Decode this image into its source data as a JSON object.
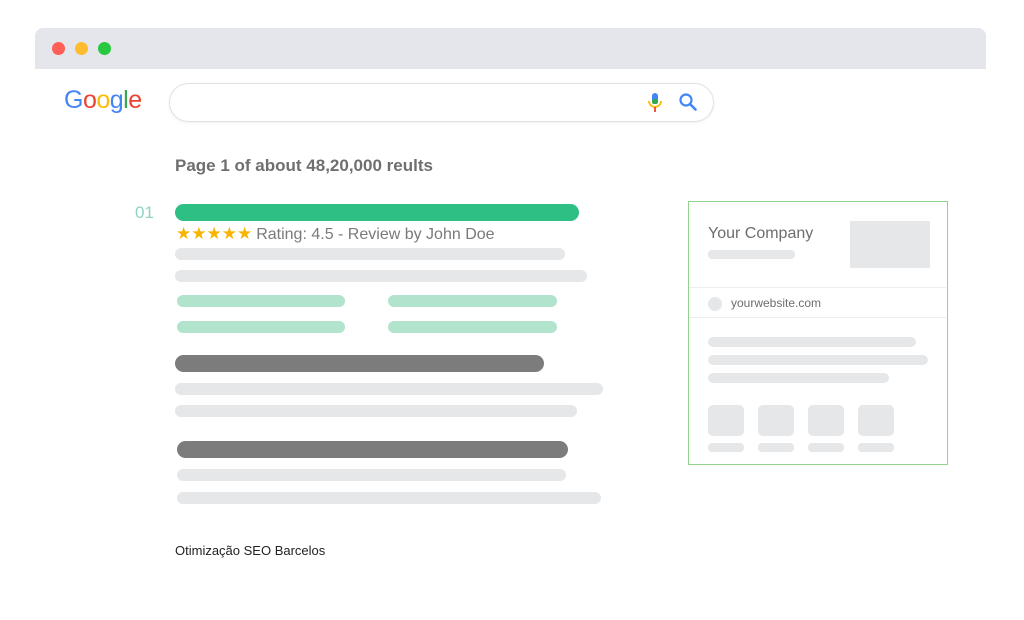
{
  "browser": {
    "window_controls": [
      "close",
      "minimize",
      "maximize"
    ],
    "colors": {
      "close": "#fe5f57",
      "minimize": "#febc2e",
      "maximize": "#28c840",
      "titlebar": "#e4e6ec"
    }
  },
  "search": {
    "logo_letters": [
      "G",
      "o",
      "o",
      "g",
      "l",
      "e"
    ],
    "logo_colors": [
      "#4285f4",
      "#ea4335",
      "#fbbc05",
      "#4285f4",
      "#34a853",
      "#ea4335"
    ],
    "query": "",
    "icons": [
      "microphone-icon",
      "search-icon"
    ]
  },
  "results": {
    "count_text": "Page 1 of about 48,20,000 reults",
    "items": [
      {
        "number": "01",
        "stars": "★★★★★",
        "rating_text": "Rating: 4.5 - Review by John Doe"
      }
    ],
    "colors": {
      "title_bar": "#2ebf85",
      "sitelinks": "#b2e3cd",
      "placeholder": "#e6e7e9",
      "subtitle": "#7c7c7c",
      "stars": "#f7b500"
    }
  },
  "knowledge_panel": {
    "title": "Your Company",
    "website": "yourwebsite.com",
    "border_color": "#8fd48f"
  },
  "caption": "Otimização SEO Barcelos"
}
